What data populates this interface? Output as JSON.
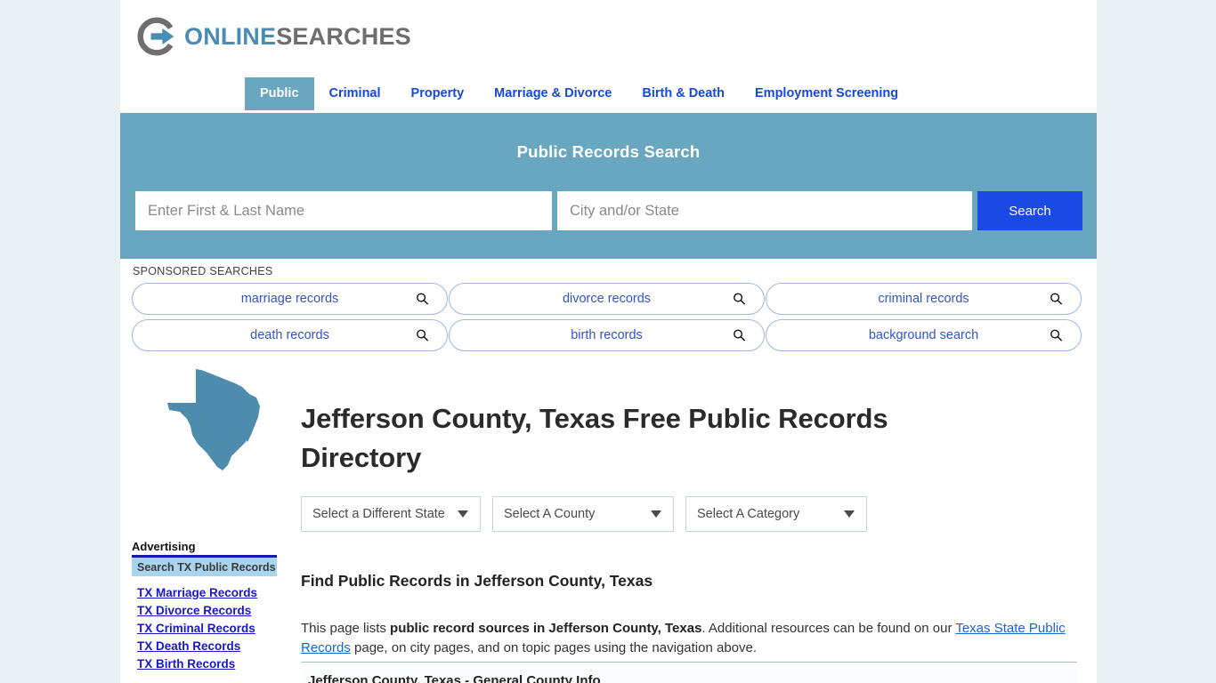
{
  "site": {
    "logo_word_1": "ONLINE",
    "logo_word_2": "SEARCHES",
    "logo_icon": "circular-arrow-logo-icon"
  },
  "nav": {
    "tabs": [
      {
        "label": "Public",
        "active": true
      },
      {
        "label": "Criminal",
        "active": false
      },
      {
        "label": "Property",
        "active": false
      },
      {
        "label": "Marriage & Divorce",
        "active": false
      },
      {
        "label": "Birth & Death",
        "active": false
      },
      {
        "label": "Employment Screening",
        "active": false
      }
    ]
  },
  "search": {
    "title": "Public Records Search",
    "name_placeholder": "Enter First & Last Name",
    "name_value": "",
    "city_placeholder": "City and/or State",
    "city_value": "",
    "button_label": "Search",
    "button_color": "#1b49e5",
    "band_color": "#69a7c0"
  },
  "sponsored": {
    "label": "SPONSORED SEARCHES",
    "items": [
      {
        "label": "marriage records",
        "icon": "magnifier-icon"
      },
      {
        "label": "divorce records",
        "icon": "magnifier-icon"
      },
      {
        "label": "criminal records",
        "icon": "magnifier-icon"
      },
      {
        "label": "death records",
        "icon": "magnifier-icon"
      },
      {
        "label": "birth records",
        "icon": "magnifier-icon"
      },
      {
        "label": "background search",
        "icon": "magnifier-icon"
      }
    ]
  },
  "main": {
    "state_map_icon": "texas-state-outline-icon",
    "state_map_color": "#4d8cad",
    "title": "Jefferson County, Texas Free Public Records Directory",
    "selects": [
      {
        "label": "Select a Different State"
      },
      {
        "label": "Select A County"
      },
      {
        "label": "Select A Category"
      }
    ],
    "section_heading": "Find Public Records in Jefferson County, Texas",
    "paragraph": {
      "part1": "This page lists ",
      "bold1": "public record sources in Jefferson County, Texas",
      "part2": ". Additional resources can be found on our ",
      "link1": "Texas State Public Records",
      "part3": " page, on city pages, and on topic pages using the navigation above."
    },
    "sub_section_title": "Jefferson County, Texas - General County Info"
  },
  "sidebar": {
    "heading": "Advertising",
    "banner_label": "Search TX Public Records",
    "links": [
      {
        "label": "TX Marriage Records"
      },
      {
        "label": "TX Divorce Records"
      },
      {
        "label": "TX Criminal Records"
      },
      {
        "label": "TX Death Records"
      },
      {
        "label": "TX Birth Records"
      }
    ]
  }
}
